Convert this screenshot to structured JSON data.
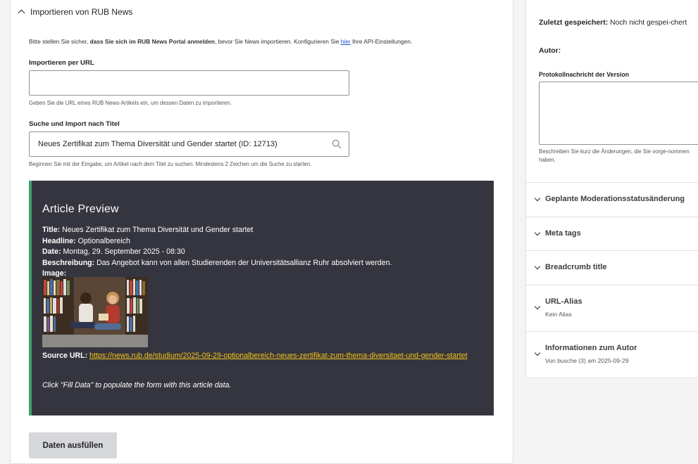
{
  "import_section": {
    "header": "Importieren von RUB News",
    "intro_pre": "Bitte stellen Sie sicher, ",
    "intro_bold": "dass Sie sich im RUB News Portal anmelden",
    "intro_mid": ", bevor Sie News importieren. Konfigurieren Sie ",
    "intro_link": "hier",
    "intro_post": " Ihre API-Einstellungen.",
    "url_label": "Importieren per URL",
    "url_value": "",
    "url_help": "Geben Sie die URL eines RUB News-Artikels ein, um dessen Daten zu importieren.",
    "search_label": "Suche und Import nach Titel",
    "search_value": "Neues Zertifikat zum Thema Diversität und Gender startet (ID: 12713)",
    "search_help": "Beginnen Sie mit der Eingabe, um Artikel nach dem Titel zu suchen. Mindestens 2 Zeichen um die Suche zu starten.",
    "search_icon": "search-icon"
  },
  "preview": {
    "heading": "Article Preview",
    "title_label": "Title:",
    "title_value": "Neues Zertifikat zum Thema Diversität und Gender startet",
    "headline_label": "Headline:",
    "headline_value": "Optionalbereich",
    "date_label": "Date:",
    "date_value": "Montag, 29. September 2025 - 08:30",
    "desc_label": "Beschreibung:",
    "desc_value": "Das Angebot kann von allen Studierenden der Universitätsallianz Ruhr absolviert werden.",
    "image_label": "Image:",
    "source_label": "Source URL:",
    "source_url": "https://news.rub.de/studium/2025-09-29-optionalbereich-neues-zertifikat-zum-thema-diversitaet-und-gender-startet",
    "hint": "Click \"Fill Data\" to populate the form with this article data.",
    "accent_color": "#3ea26b",
    "bg_color": "#35353f",
    "link_color": "#f5c518"
  },
  "fill_button": "Daten ausfüllen",
  "sidebar": {
    "last_saved_label": "Zuletzt gespeichert:",
    "last_saved_value": "Noch nicht gespei-chert",
    "author_label": "Autor:",
    "log_label": "Protokollnachricht der Version",
    "log_value": "",
    "log_help": "Beschreiben Sie kurz die Änderungen, die Sie vorge-nommen haben.",
    "accordions": [
      {
        "title": "Geplante Moderationsstatusänderung",
        "sub": ""
      },
      {
        "title": "Meta tags",
        "sub": ""
      },
      {
        "title": "Breadcrumb title",
        "sub": ""
      },
      {
        "title": "URL-Alias",
        "sub": "Kein Alias"
      },
      {
        "title": "Informationen zum Autor",
        "sub": "Von busche (3) am 2025-09-29"
      }
    ]
  }
}
